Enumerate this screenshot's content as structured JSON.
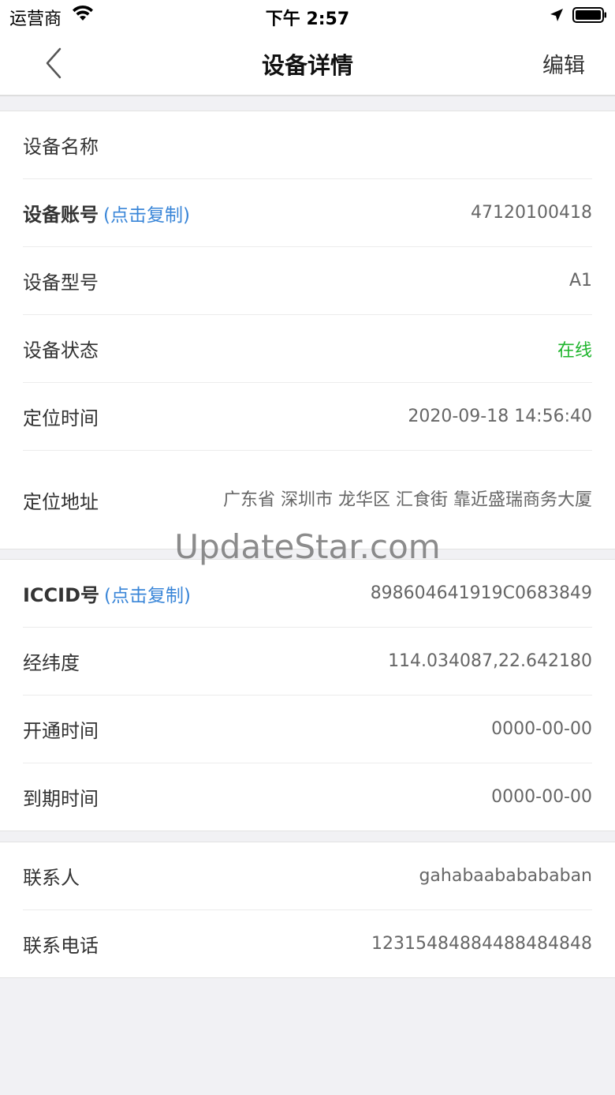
{
  "status_bar": {
    "carrier": "运营商",
    "time": "下午 2:57"
  },
  "nav": {
    "title": "设备详情",
    "edit_label": "编辑"
  },
  "copy_hint": "(点击复制)",
  "sections": [
    {
      "rows": [
        {
          "label": "设备名称",
          "value": ""
        },
        {
          "label": "设备账号",
          "value": "47120100418"
        },
        {
          "label": "设备型号",
          "value": "A1"
        },
        {
          "label": "设备状态",
          "value": "在线"
        },
        {
          "label": "定位时间",
          "value": "2020-09-18 14:56:40"
        },
        {
          "label": "定位地址",
          "value": "广东省 深圳市 龙华区 汇食街 靠近盛瑞商务大厦"
        }
      ]
    },
    {
      "rows": [
        {
          "label": "ICCID号",
          "value": "898604641919C0683849"
        },
        {
          "label": "经纬度",
          "value": "114.034087,22.642180"
        },
        {
          "label": "开通时间",
          "value": "0000-00-00"
        },
        {
          "label": "到期时间",
          "value": "0000-00-00"
        }
      ]
    },
    {
      "rows": [
        {
          "label": "联系人",
          "value": "gahabaababababan"
        },
        {
          "label": "联系电话",
          "value": "12315484884488484848"
        }
      ]
    }
  ],
  "watermark": "UpdateStar.com",
  "colors": {
    "status_online": "#1fb52d",
    "copy_link": "#3a86d8",
    "background": "#f1f1f4"
  }
}
